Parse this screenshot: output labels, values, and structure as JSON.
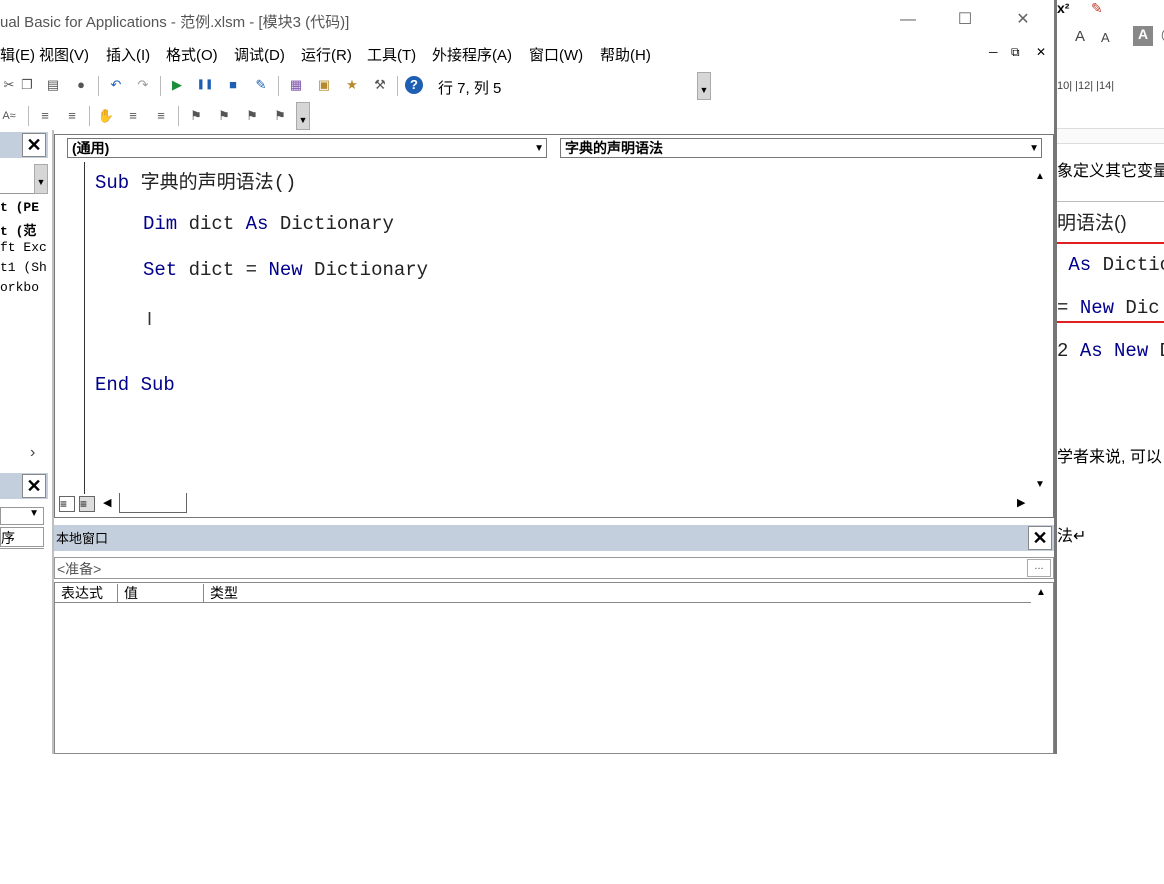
{
  "window": {
    "title": "ual Basic for Applications - 范例.xlsm - [模块3 (代码)]"
  },
  "menu": [
    {
      "label": "辑(E)"
    },
    {
      "label": "视图(V)"
    },
    {
      "label": "插入(I)"
    },
    {
      "label": "格式(O)"
    },
    {
      "label": "调试(D)"
    },
    {
      "label": "运行(R)"
    },
    {
      "label": "工具(T)"
    },
    {
      "label": "外接程序(A)"
    },
    {
      "label": "窗口(W)"
    },
    {
      "label": "帮助(H)"
    }
  ],
  "toolbar": {
    "cursor_position": "行 7, 列 5"
  },
  "project_tree": {
    "items": [
      "t (PE",
      "t (范",
      "ft Exc",
      "t1 (Sh",
      "orkbo"
    ]
  },
  "properties_pane": {
    "label": "序"
  },
  "code_window": {
    "object_combo": "(通用)",
    "procedure_combo": "字典的声明语法",
    "lines": {
      "l1_kw": "Sub",
      "l1_rest": " 字典的声明语法()",
      "l2_kw1": "Dim",
      "l2_mid": " dict ",
      "l2_kw2": "As",
      "l2_rest": " Dictionary",
      "l3_kw1": "Set",
      "l3_mid": " dict = ",
      "l3_kw2": "New",
      "l3_rest": " Dictionary",
      "l4": "End Sub"
    }
  },
  "locals_window": {
    "title": "本地窗口",
    "context": "<准备>",
    "context_button": "...",
    "columns": [
      "表达式",
      "值",
      "类型"
    ]
  },
  "background_document": {
    "ruler": "10|  |12|  |14|",
    "line1": "象定义其它变量",
    "line2": "明语法()",
    "line3_kw": "As",
    "line3_rest": " Dictio",
    "line4_pre": " = ",
    "line4_kw": "New",
    "line4_rest": " Dic",
    "line5_pre": "2 ",
    "line5_kw1": "As",
    "line5_mid": " ",
    "line5_kw2": "New",
    "line5_rest": " D",
    "line6": "学者来说, 可以",
    "line7": "法↵"
  }
}
